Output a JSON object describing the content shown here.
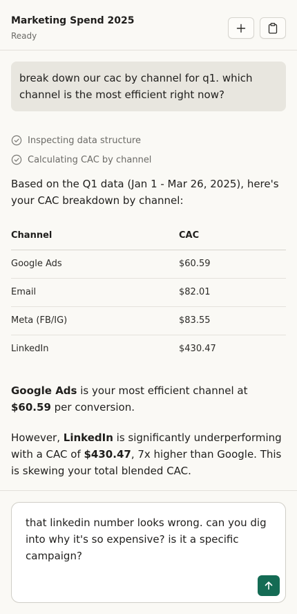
{
  "header": {
    "title": "Marketing Spend 2025",
    "status": "Ready",
    "new_icon": "plus-icon",
    "clipboard_icon": "clipboard-icon"
  },
  "user_message": "break down our cac by channel for q1. which channel is the most efficient right now?",
  "steps": [
    {
      "icon": "check-circle-icon",
      "label": "Inspecting data structure"
    },
    {
      "icon": "check-circle-icon",
      "label": "Calculating CAC by channel"
    }
  ],
  "response": {
    "intro": "Based on the Q1 data (Jan 1 - Mar 26, 2025), here's your CAC breakdown by channel:",
    "table": {
      "headers": [
        "Channel",
        "CAC"
      ],
      "rows": [
        [
          "Google Ads",
          "$60.59"
        ],
        [
          "Email",
          "$82.01"
        ],
        [
          "Meta (FB/IG)",
          "$83.55"
        ],
        [
          "LinkedIn",
          "$430.47"
        ]
      ]
    },
    "p2": {
      "bold1": "Google Ads",
      "text1": " is your most efficient channel at ",
      "bold2": "$60.59",
      "text2": " per conversion."
    },
    "p3": {
      "text0": "However, ",
      "bold1": "LinkedIn",
      "text1": " is significantly underperforming with a CAC of ",
      "bold2": "$430.47",
      "text2": ", 7x higher than Google. This is skewing your total blended CAC."
    }
  },
  "composer": {
    "value": "that linkedin number looks wrong. can you dig into why it's so expensive? is it a specific campaign?",
    "send_icon": "arrow-up-icon"
  },
  "colors": {
    "background": "#faf9f5",
    "user_bubble": "#e8e6df",
    "send_button": "#146b54"
  }
}
